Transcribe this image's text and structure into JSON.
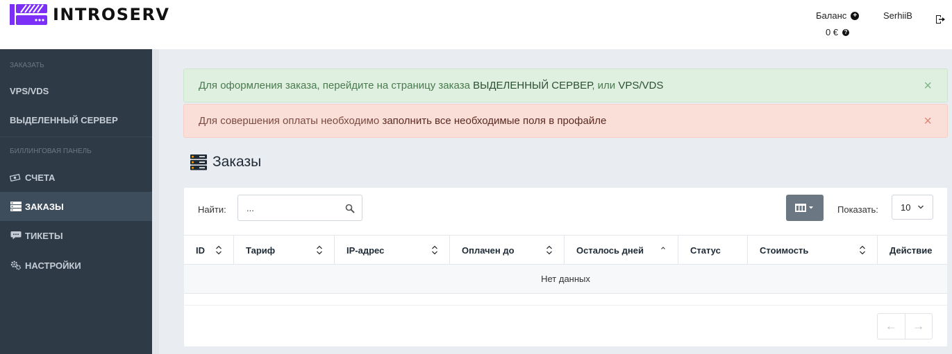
{
  "header": {
    "brand": "INTROSERV",
    "balance_label": "Баланс",
    "balance_value": "0 €",
    "username": "SerhiiB"
  },
  "icons": {
    "balance_add": "plus-circle-icon",
    "balance_help": "question-circle-icon",
    "logout": "logout-icon",
    "invoices": "money-icon",
    "orders": "server-list-icon",
    "tickets": "chat-icon",
    "settings": "gears-icon",
    "search": "search-icon",
    "columns": "columns-icon"
  },
  "sidebar": {
    "section_order": "ЗАКАЗАТЬ",
    "order_items": [
      {
        "label": "VPS/VDS"
      },
      {
        "label": "ВЫДЕЛЕННЫЙ СЕРВЕР"
      }
    ],
    "section_billing": "БИЛЛИНГОВАЯ ПАНЕЛЬ",
    "billing_items": [
      {
        "label": "СЧЕТА"
      },
      {
        "label": "ЗАКАЗЫ",
        "active": true
      },
      {
        "label": "ТИКЕТЫ"
      },
      {
        "label": "НАСТРОЙКИ"
      }
    ]
  },
  "alerts": {
    "success_prefix": "Для оформления заказа, перейдите на страницу заказа ",
    "success_link1": "ВЫДЕЛЕННЫЙ СЕРВЕР",
    "success_mid": ", или ",
    "success_link2": "VPS/VDS",
    "danger_prefix": "Для совершения оплаты необходимо ",
    "danger_link": "заполнить все необходимые поля в профайле",
    "close_glyph": "×"
  },
  "page": {
    "title": "Заказы"
  },
  "table": {
    "search_label": "Найти:",
    "search_value": "...",
    "show_label": "Показать:",
    "page_size": "10",
    "columns": [
      {
        "label": "ID",
        "sortable": true
      },
      {
        "label": "Тариф",
        "sortable": true
      },
      {
        "label": "IP-адрес",
        "sortable": true
      },
      {
        "label": "Оплачен до",
        "sortable": true
      },
      {
        "label": "Осталось дней",
        "sortable": true,
        "sorted": "asc"
      },
      {
        "label": "Статус",
        "sortable": false
      },
      {
        "label": "Стоимость",
        "sortable": true
      },
      {
        "label": "Действие",
        "sortable": false
      }
    ],
    "empty_text": "Нет данных",
    "prev_label": "←",
    "next_label": "→"
  },
  "colors": {
    "sidebar_bg": "#2e3b47",
    "sidebar_active": "#3e4d5b",
    "brand_purple": "#7b2ff7",
    "success_bg": "#dff0e0",
    "danger_bg": "#fadfd8",
    "column_button": "#6b7782"
  }
}
